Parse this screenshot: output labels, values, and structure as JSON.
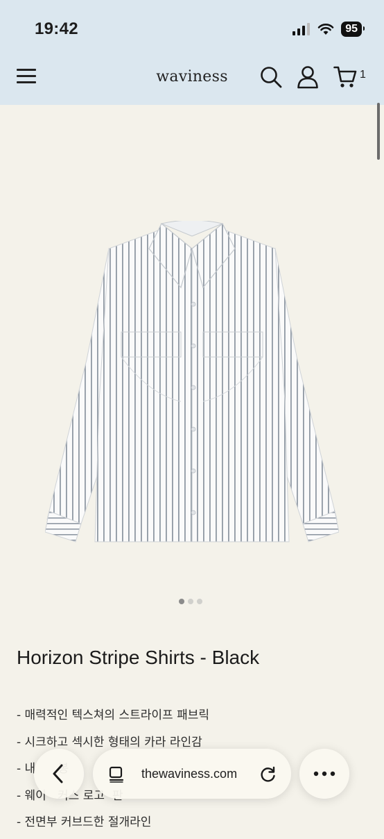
{
  "status_bar": {
    "time": "19:42",
    "battery": "95"
  },
  "header": {
    "logo": "waviness",
    "cart_count": "1"
  },
  "product": {
    "title": "Horizon Stripe Shirts - Black",
    "image_dots": [
      true,
      false,
      false
    ],
    "features": [
      "- 매력적인 텍스쳐의 스트라이프 패브릭",
      "- 시크하고 섹시한 형태의 카라 라인감",
      "- 내",
      "- 웨이",
      "- 전면부 커브드한 절개라인"
    ],
    "partial_words": [
      "봉",
      "커스 로고",
      "판"
    ]
  },
  "browser": {
    "url": "thewaviness.com"
  },
  "colors": {
    "header_bg": "#dbe7ef",
    "page_bg": "#f4f2ea",
    "stripe": "#8f98a3"
  }
}
